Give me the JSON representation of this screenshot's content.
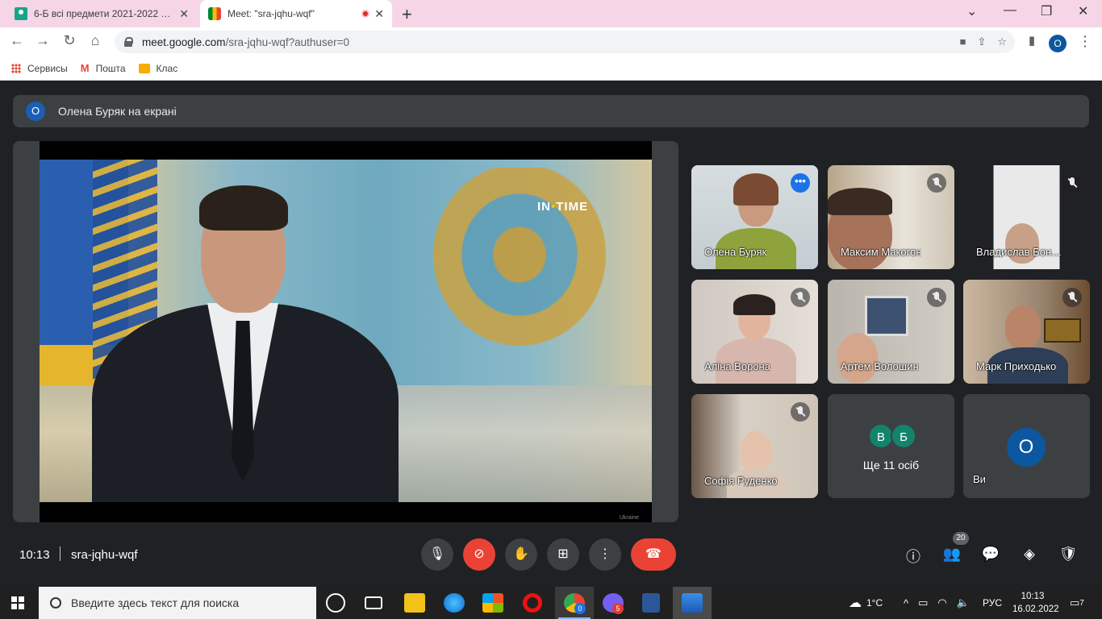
{
  "browser": {
    "tabs": [
      {
        "title": "6-Б всі предмети 2021-2022 Бур",
        "icon": "classroom-icon",
        "active": false
      },
      {
        "title": "Meet: \"sra-jqhu-wqf\"",
        "icon": "meet-icon",
        "active": true,
        "recording": true
      }
    ],
    "url_host": "meet.google.com",
    "url_path": "/sra-jqhu-wqf?authuser=0",
    "profile_initial": "O",
    "bookmarks": [
      "Сервисы",
      "Пошта",
      "Клас"
    ]
  },
  "meet": {
    "presenter_initial": "О",
    "presenter_text": "Олена Буряк на екрані",
    "video_watermark_a": "IN",
    "video_watermark_dot": "•",
    "video_watermark_b": "TIME",
    "video_caption": "Ukraine",
    "participants": [
      {
        "name": "Олена Буряк",
        "speaking": true,
        "muted": false
      },
      {
        "name": "Максим Макогон",
        "muted": true
      },
      {
        "name": "Владислав Бон…",
        "muted": true
      },
      {
        "name": "Аліна Ворона",
        "muted": true
      },
      {
        "name": "Артем Волошин",
        "muted": true
      },
      {
        "name": "Марк Приходько",
        "muted": true
      },
      {
        "name": "Софія Руденко",
        "muted": true
      }
    ],
    "others": {
      "initials": [
        "В",
        "Б"
      ],
      "label": "Ще 11 осіб"
    },
    "self": {
      "initial": "O",
      "label": "Ви"
    },
    "time": "10:13",
    "meeting_code": "sra-jqhu-wqf",
    "people_count": "20",
    "colors": {
      "accent": "#8ab4f8",
      "end_call": "#ea4335",
      "bg": "#202124",
      "tile": "#3c4043"
    }
  },
  "taskbar": {
    "search_placeholder": "Введите здесь текст для поиска",
    "weather": "1°C",
    "lang": "РУС",
    "time": "10:13",
    "date": "16.02.2022",
    "notifications": "7",
    "chrome_badge": "0",
    "viber_badge": "5"
  }
}
